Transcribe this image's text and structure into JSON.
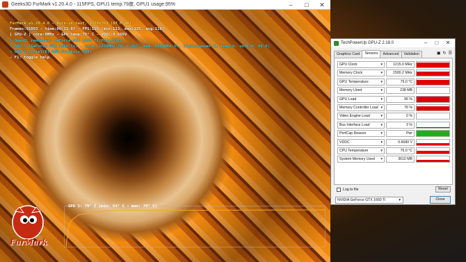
{
  "furmark": {
    "title": "Geeks3D FurMark v1.20.4.0 - 115FPS, GPU1 temp:79度, GPU1 usage:95%",
    "overlay": [
      {
        "text": "FurMark v1.20.4.0 - Burn-in test, 1024x768 (8X MSAA)",
        "color": "yellow"
      },
      {
        "text": "Frames:91093 - time:00:13:07 - FPS:115 (min:113, max:125, avg:116)",
        "color": "white"
      },
      {
        "text": "[ GPU-Z ] core:0MHz - GPU temp:79° C - VDDC:0.668V",
        "color": "white"
      },
      {
        "text": "> OpenGL renderer: GeForce GTX 1660 Ti/PCIe/SSE2",
        "color": "cyan"
      },
      {
        "text": "> GPU 1 (GeForce GTX 1660 Ti) - core: 1230MHz:79° C:95%, mem: 6000MHz:3%, limits(power:1, temp:0, volt:0, OV:0)",
        "color": "cyan"
      },
      {
        "text": "> GPU 2 (Intel(R) UHD Graphics 630)",
        "color": "cyan"
      },
      {
        "text": "- F1: toggle help",
        "color": "white"
      }
    ],
    "graph_label": "GPU 1: 79° C (min: 54° C - max: 79° C)",
    "graph_color": "#f5a623",
    "logo_text": "FurMark"
  },
  "gpuz": {
    "title": "TechPowerUp GPU-Z 2.18.0",
    "tabs": [
      "Graphics Card",
      "Sensors",
      "Advanced",
      "Validation"
    ],
    "active_tab": "Sensors",
    "sensors": [
      {
        "name": "GPU Clock",
        "value": "1215.0 MHz",
        "fill": 0.85,
        "color": "#e00000"
      },
      {
        "name": "Memory Clock",
        "value": "1500.2 MHz",
        "fill": 0.85,
        "color": "#e00000"
      },
      {
        "name": "GPU Temperature",
        "value": "79.0 °C",
        "fill": 0.8,
        "color": "#e00000"
      },
      {
        "name": "Memory Used",
        "value": "238 MB",
        "fill": 0.05,
        "color": "#e00000"
      },
      {
        "name": "GPU Load",
        "value": "95 %",
        "fill": 0.95,
        "color": "#e00000"
      },
      {
        "name": "Memory Controller Load",
        "value": "76 %",
        "fill": 0.76,
        "color": "#e00000"
      },
      {
        "name": "Video Engine Load",
        "value": "0 %",
        "fill": 0.0,
        "color": "#e00000"
      },
      {
        "name": "Bus Interface Load",
        "value": "3 %",
        "fill": 0.05,
        "color": "#e00000"
      },
      {
        "name": "PerfCap Reason",
        "value": "Pwr",
        "fill": 1.0,
        "color": "#1fae1f"
      },
      {
        "name": "VDDC",
        "value": "0.6680 V",
        "fill": 0.35,
        "color": "#e00000"
      },
      {
        "name": "CPU Temperature",
        "value": "76.0 °C",
        "fill": 0.55,
        "color": "#e00000"
      },
      {
        "name": "System Memory Used",
        "value": "3610 MB",
        "fill": 0.4,
        "color": "#e00000"
      }
    ],
    "log_label": "Log to file",
    "reset_label": "Reset",
    "gpu_select": "NVIDIA GeForce GTX 1660 Ti",
    "close_label": "Close"
  }
}
